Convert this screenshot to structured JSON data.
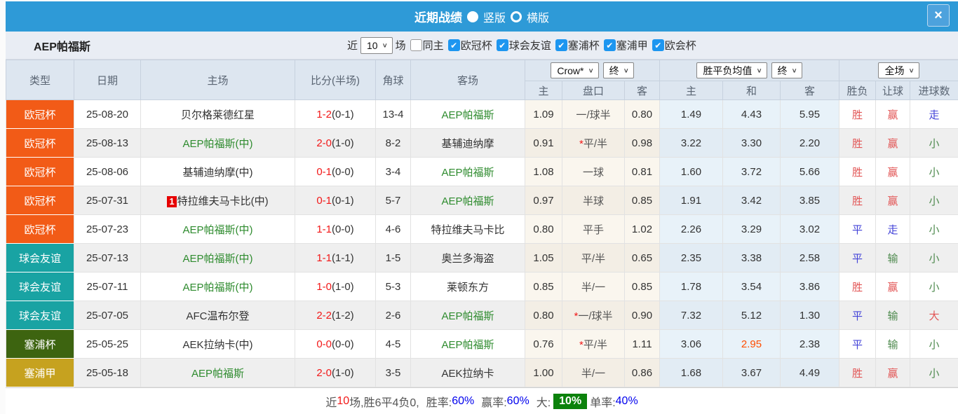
{
  "topbar": {
    "title": "近期战绩",
    "radio_vertical": "竖版",
    "radio_horizontal": "横版",
    "close": "×"
  },
  "filter": {
    "team": "AEP帕福斯",
    "near_label": "近",
    "near_value": "10",
    "matches_label": "场",
    "same_home_label": "同主",
    "leagues": [
      "欧冠杯",
      "球会友谊",
      "塞浦杯",
      "塞浦甲",
      "欧会杯"
    ]
  },
  "table": {
    "left_headers": [
      "类型",
      "日期",
      "主场",
      "比分(半场)",
      "角球",
      "客场"
    ],
    "selects": {
      "bookmaker": "Crow*",
      "bookmaker_period": "终",
      "odds_avg": "胜平负均值",
      "odds_avg_period": "终",
      "scope": "全场"
    },
    "subheaders": [
      "主",
      "盘口",
      "客",
      "主",
      "和",
      "客",
      "胜负",
      "让球",
      "进球数"
    ],
    "rows": [
      {
        "type": "欧冠杯",
        "date": "25-08-20",
        "home": "贝尔格莱德红星",
        "home_green": false,
        "marker": "",
        "score": "1-2",
        "half": "(0-1)",
        "corner": "13-4",
        "away": "AEP帕福斯",
        "away_green": true,
        "odds_home": "1.09",
        "handicap_star": "",
        "handicap": "一/球半",
        "odds_away": "0.80",
        "avg_home": "1.49",
        "avg_draw": "4.43",
        "avg_draw_hl": false,
        "avg_away": "5.95",
        "result": "胜",
        "result_color": "red",
        "handicap_result": "赢",
        "handicap_result_color": "red",
        "goals_result": "走",
        "goals_result_color": "blue"
      },
      {
        "type": "欧冠杯",
        "date": "25-08-13",
        "home": "AEP帕福斯(中)",
        "home_green": true,
        "marker": "",
        "score": "2-0",
        "half": "(1-0)",
        "corner": "8-2",
        "away": "基辅迪纳摩",
        "away_green": false,
        "odds_home": "0.91",
        "handicap_star": "*",
        "handicap": "平/半",
        "odds_away": "0.98",
        "avg_home": "3.22",
        "avg_draw": "3.30",
        "avg_draw_hl": false,
        "avg_away": "2.20",
        "result": "胜",
        "result_color": "red",
        "handicap_result": "赢",
        "handicap_result_color": "red",
        "goals_result": "小",
        "goals_result_color": "green"
      },
      {
        "type": "欧冠杯",
        "date": "25-08-06",
        "home": "基辅迪纳摩(中)",
        "home_green": false,
        "marker": "",
        "score": "0-1",
        "half": "(0-0)",
        "corner": "3-4",
        "away": "AEP帕福斯",
        "away_green": true,
        "odds_home": "1.08",
        "handicap_star": "",
        "handicap": "一球",
        "odds_away": "0.81",
        "avg_home": "1.60",
        "avg_draw": "3.72",
        "avg_draw_hl": false,
        "avg_away": "5.66",
        "result": "胜",
        "result_color": "red",
        "handicap_result": "赢",
        "handicap_result_color": "red",
        "goals_result": "小",
        "goals_result_color": "green"
      },
      {
        "type": "欧冠杯",
        "date": "25-07-31",
        "home": "特拉维夫马卡比(中)",
        "home_green": false,
        "marker": "1",
        "score": "0-1",
        "half": "(0-1)",
        "corner": "5-7",
        "away": "AEP帕福斯",
        "away_green": true,
        "odds_home": "0.97",
        "handicap_star": "",
        "handicap": "半球",
        "odds_away": "0.85",
        "avg_home": "1.91",
        "avg_draw": "3.42",
        "avg_draw_hl": false,
        "avg_away": "3.85",
        "result": "胜",
        "result_color": "red",
        "handicap_result": "赢",
        "handicap_result_color": "red",
        "goals_result": "小",
        "goals_result_color": "green"
      },
      {
        "type": "欧冠杯",
        "date": "25-07-23",
        "home": "AEP帕福斯(中)",
        "home_green": true,
        "marker": "",
        "score": "1-1",
        "half": "(0-0)",
        "corner": "4-6",
        "away": "特拉维夫马卡比",
        "away_green": false,
        "odds_home": "0.80",
        "handicap_star": "",
        "handicap": "平手",
        "odds_away": "1.02",
        "avg_home": "2.26",
        "avg_draw": "3.29",
        "avg_draw_hl": false,
        "avg_away": "3.02",
        "result": "平",
        "result_color": "blue",
        "handicap_result": "走",
        "handicap_result_color": "blue",
        "goals_result": "小",
        "goals_result_color": "green"
      },
      {
        "type": "球会友谊",
        "date": "25-07-13",
        "home": "AEP帕福斯(中)",
        "home_green": true,
        "marker": "",
        "score": "1-1",
        "half": "(1-1)",
        "corner": "1-5",
        "away": "奥兰多海盗",
        "away_green": false,
        "odds_home": "1.05",
        "handicap_star": "",
        "handicap": "平/半",
        "odds_away": "0.65",
        "avg_home": "2.35",
        "avg_draw": "3.38",
        "avg_draw_hl": false,
        "avg_away": "2.58",
        "result": "平",
        "result_color": "blue",
        "handicap_result": "输",
        "handicap_result_color": "green",
        "goals_result": "小",
        "goals_result_color": "green"
      },
      {
        "type": "球会友谊",
        "date": "25-07-11",
        "home": "AEP帕福斯(中)",
        "home_green": true,
        "marker": "",
        "score": "1-0",
        "half": "(1-0)",
        "corner": "5-3",
        "away": "莱顿东方",
        "away_green": false,
        "odds_home": "0.85",
        "handicap_star": "",
        "handicap": "半/一",
        "odds_away": "0.85",
        "avg_home": "1.78",
        "avg_draw": "3.54",
        "avg_draw_hl": false,
        "avg_away": "3.86",
        "result": "胜",
        "result_color": "red",
        "handicap_result": "赢",
        "handicap_result_color": "red",
        "goals_result": "小",
        "goals_result_color": "green"
      },
      {
        "type": "球会友谊",
        "date": "25-07-05",
        "home": "AFC温布尔登",
        "home_green": false,
        "marker": "",
        "score": "2-2",
        "half": "(1-2)",
        "corner": "2-6",
        "away": "AEP帕福斯",
        "away_green": true,
        "odds_home": "0.80",
        "handicap_star": "*",
        "handicap": "一/球半",
        "odds_away": "0.90",
        "avg_home": "7.32",
        "avg_draw": "5.12",
        "avg_draw_hl": false,
        "avg_away": "1.30",
        "result": "平",
        "result_color": "blue",
        "handicap_result": "输",
        "handicap_result_color": "green",
        "goals_result": "大",
        "goals_result_color": "red"
      },
      {
        "type": "塞浦杯",
        "date": "25-05-25",
        "home": "AEK拉纳卡(中)",
        "home_green": false,
        "marker": "",
        "score": "0-0",
        "half": "(0-0)",
        "corner": "4-5",
        "away": "AEP帕福斯",
        "away_green": true,
        "odds_home": "0.76",
        "handicap_star": "*",
        "handicap": "平/半",
        "odds_away": "1.11",
        "avg_home": "3.06",
        "avg_draw": "2.95",
        "avg_draw_hl": true,
        "avg_away": "2.38",
        "result": "平",
        "result_color": "blue",
        "handicap_result": "输",
        "handicap_result_color": "green",
        "goals_result": "小",
        "goals_result_color": "green"
      },
      {
        "type": "塞浦甲",
        "date": "25-05-18",
        "home": "AEP帕福斯",
        "home_green": true,
        "marker": "",
        "score": "2-0",
        "half": "(1-0)",
        "corner": "3-5",
        "away": "AEK拉纳卡",
        "away_green": false,
        "odds_home": "1.00",
        "handicap_star": "",
        "handicap": "半/一",
        "odds_away": "0.86",
        "avg_home": "1.68",
        "avg_draw": "3.67",
        "avg_draw_hl": false,
        "avg_away": "4.49",
        "result": "胜",
        "result_color": "red",
        "handicap_result": "赢",
        "handicap_result_color": "red",
        "goals_result": "小",
        "goals_result_color": "green"
      }
    ]
  },
  "summary": {
    "prefix": "近",
    "count": "10",
    "record": "场,胜6平4负0,",
    "win_rate_label": "胜率:",
    "win_rate": "60%",
    "handicap_rate_label": "赢率:",
    "handicap_rate": "60%",
    "big_label": "大:",
    "big_rate": "10%",
    "single_label": "单率:",
    "single_rate": "40%"
  },
  "colors": {
    "topbar_blue": "#2e9ad7",
    "badges": {
      "欧冠杯": "#f25b17",
      "球会友谊": "#19a3a3",
      "塞浦杯": "#3d6410",
      "塞浦甲": "#c6a21f"
    },
    "score_red": "#f21818",
    "team_green": "#2e8b2e",
    "result_red": "#e25555",
    "result_blue": "#4343d8",
    "result_green": "#4e8a4e",
    "highlight_orange": "#ff4d00",
    "summary_chip_green": "#0c820c",
    "percent_blue": "#0000ee",
    "checkbox_blue": "#1d96f0"
  }
}
